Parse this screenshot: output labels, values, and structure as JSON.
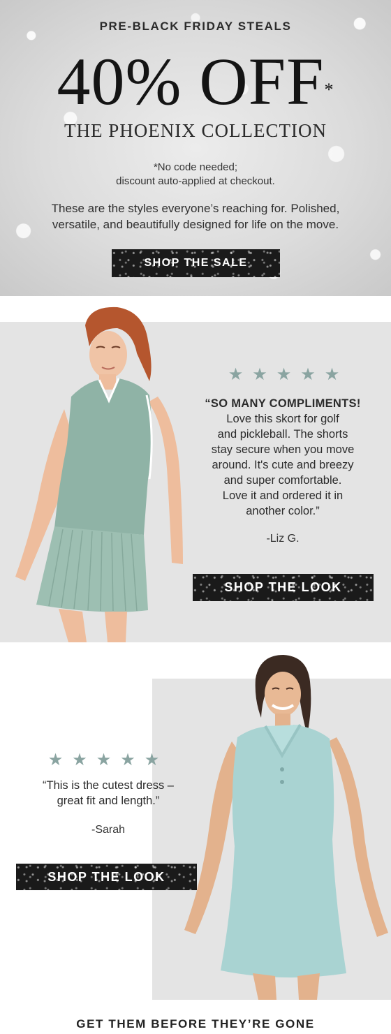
{
  "hero": {
    "eyebrow": "PRE-BLACK FRIDAY STEALS",
    "offer": "40% OFF",
    "offer_mark": "*",
    "collection": "THE PHOENIX COLLECTION",
    "fineprint_line1": "*No code needed;",
    "fineprint_line2": "discount auto-applied at checkout.",
    "body_line1": "These are the styles everyone’s reaching for. Polished,",
    "body_line2": "versatile, and beautifully designed for life on the move.",
    "cta_label": "SHOP THE SALE"
  },
  "review1": {
    "stars": "★★★★★",
    "rating": 5,
    "headline": "“SO MANY COMPLIMENTS!",
    "quote_lines": [
      "Love this skort for golf",
      "and pickleball. The shorts",
      "stay secure when you move",
      "around. It's cute and breezy",
      "and super comfortable.",
      "Love it and ordered it in",
      "another color.”"
    ],
    "author": "-Liz G.",
    "cta_label": "SHOP THE LOOK"
  },
  "review2": {
    "stars": "★★★★★",
    "rating": 5,
    "quote_lines": [
      "“This is the cutest dress –",
      "great fit and length.”"
    ],
    "author": "-Sarah",
    "cta_label": "SHOP THE LOOK"
  },
  "footer": {
    "cta": "GET THEM BEFORE THEY’RE GONE"
  },
  "colors": {
    "star": "#8aa4a1",
    "button": "#1a1a1a",
    "panel": "#e4e4e4",
    "garment_sage": "#8fb3a6",
    "garment_aqua": "#a9d3d2"
  }
}
